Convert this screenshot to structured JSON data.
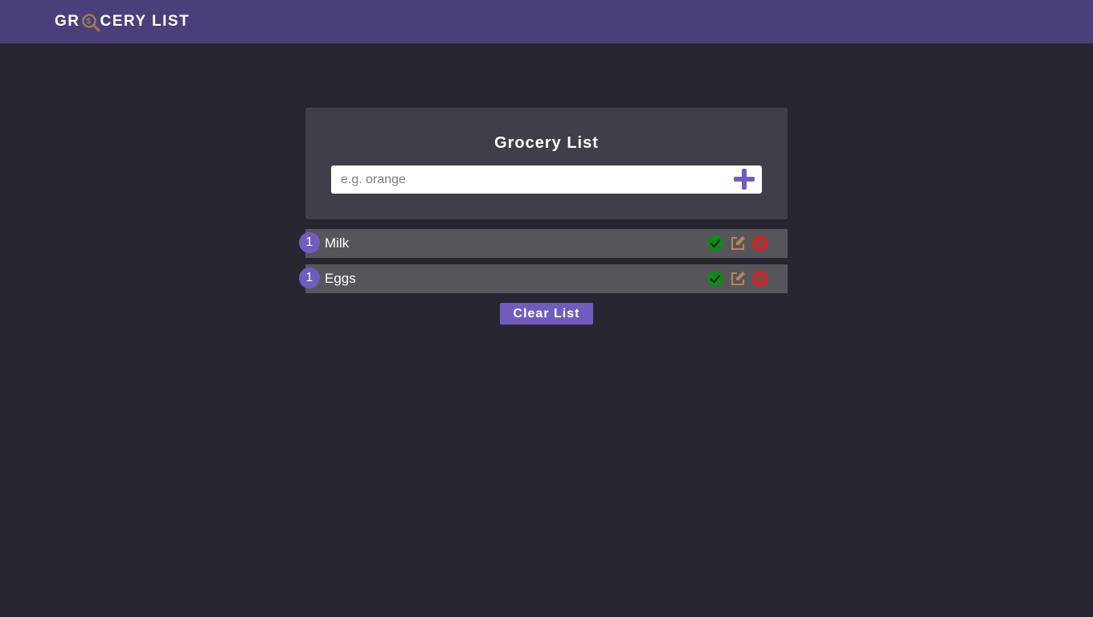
{
  "navbar": {
    "brand_prefix": "GR",
    "brand_suffix": "CERY LIST",
    "logo_icon": "magnifier-dollar-icon",
    "background": "#4b3f7b"
  },
  "card": {
    "title": "Grocery List",
    "input": {
      "value": "",
      "placeholder": "e.g. orange"
    },
    "add_icon": "plus-icon"
  },
  "list": {
    "items": [
      {
        "count": "1",
        "name": "Milk"
      },
      {
        "count": "1",
        "name": "Eggs"
      }
    ],
    "action_icons": [
      "check-circle-icon",
      "edit-icon",
      "close-circle-icon"
    ]
  },
  "clear_button": {
    "label": "Clear List"
  },
  "colors": {
    "page_background": "#27252f",
    "accent": "#6f5cbe",
    "check": "#0e8a16",
    "edit": "#b8874a",
    "delete": "#c62828"
  }
}
